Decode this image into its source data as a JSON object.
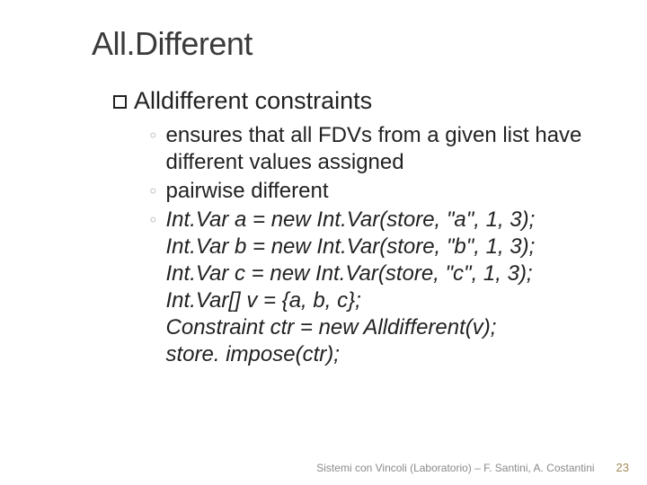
{
  "title": "All.Different",
  "l1": {
    "text": "Alldifferent constraints"
  },
  "l2": {
    "items": [
      {
        "kind": "plain",
        "text": "ensures that all FDVs from a given list have different values assigned"
      },
      {
        "kind": "plain",
        "text": " pairwise different"
      },
      {
        "kind": "code",
        "lines": [
          "Int.Var a = new Int.Var(store, \"a\", 1, 3);",
          "Int.Var b = new Int.Var(store, \"b\", 1, 3);",
          "Int.Var c = new Int.Var(store, \"c\", 1, 3);",
          "Int.Var[] v = {a, b, c};",
          "Constraint ctr = new Alldifferent(v);",
          "store. impose(ctr);"
        ]
      }
    ]
  },
  "footer": {
    "credit": "Sistemi con Vincoli (Laboratorio) – F. Santini,  A. Costantini",
    "page": "23"
  }
}
